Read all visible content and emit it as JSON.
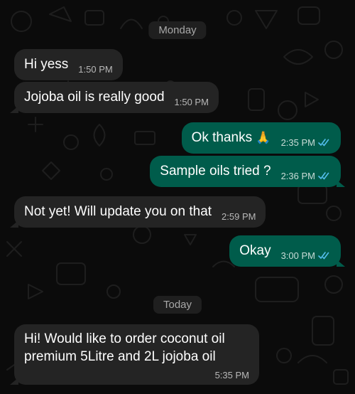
{
  "theme": {
    "background": "#0b0b0b",
    "incoming_bubble": "#242424",
    "outgoing_bubble": "#005c4b",
    "date_pill": "#1f1f1f",
    "read_tick": "#53bdeb"
  },
  "dates": {
    "monday": "Monday",
    "today": "Today"
  },
  "messages": [
    {
      "direction": "incoming",
      "text": "Hi yess",
      "time": "1:50 PM"
    },
    {
      "direction": "incoming",
      "text": "Jojoba oil is really good",
      "time": "1:50 PM"
    },
    {
      "direction": "outgoing",
      "text": "Ok thanks",
      "emoji": "🙏",
      "time": "2:35 PM",
      "status": "read"
    },
    {
      "direction": "outgoing",
      "text": "Sample oils tried ?",
      "time": "2:36 PM",
      "status": "read"
    },
    {
      "direction": "incoming",
      "text": "Not yet! Will update you on that",
      "time": "2:59 PM"
    },
    {
      "direction": "outgoing",
      "text": "Okay",
      "time": "3:00 PM",
      "status": "read"
    },
    {
      "direction": "incoming",
      "text": "Hi! Would like to order coconut oil premium 5Litre and 2L jojoba oil",
      "time": "5:35 PM"
    }
  ]
}
